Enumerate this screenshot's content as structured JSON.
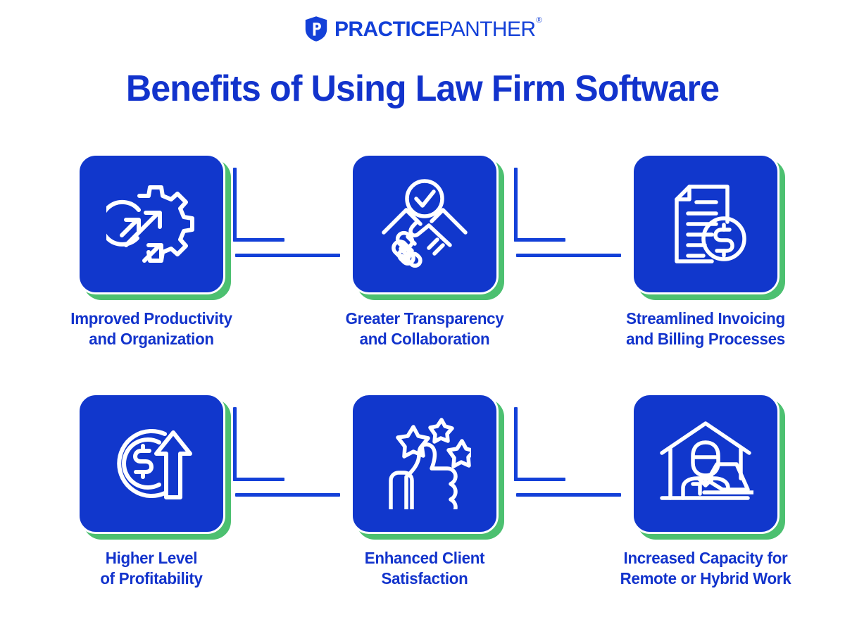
{
  "brand": {
    "logo_icon": "practicepanther-shield-p-icon",
    "name_bold": "PRACTICE",
    "name_light": "PANTHER",
    "registered_mark": "®",
    "color_blue": "#1340d8"
  },
  "header": {
    "title": "Benefits of Using Law Firm Software"
  },
  "theme": {
    "card_blue": "#1137cc",
    "card_shadow_green": "#4cc070",
    "text_blue": "#1233cc",
    "icon_white": "#ffffff",
    "background": "#ffffff"
  },
  "benefits": [
    {
      "icon": "gear-with-growth-arrows-icon",
      "caption_line1": "Improved Productivity",
      "caption_line2": "and Organization"
    },
    {
      "icon": "handshake-with-check-icon",
      "caption_line1": "Greater Transparency",
      "caption_line2": "and Collaboration"
    },
    {
      "icon": "invoice-document-dollar-icon",
      "caption_line1": "Streamlined Invoicing",
      "caption_line2": "and Billing Processes"
    },
    {
      "icon": "dollar-coin-up-arrow-icon",
      "caption_line1": "Higher Level",
      "caption_line2": "of Profitability"
    },
    {
      "icon": "thumbs-up-stars-icon",
      "caption_line1": "Enhanced Client",
      "caption_line2": "Satisfaction"
    },
    {
      "icon": "remote-work-house-laptop-icon",
      "caption_line1": "Increased Capacity for",
      "caption_line2": "Remote or Hybrid Work"
    }
  ],
  "connectors": [
    {
      "name": "connector-1-to-2"
    },
    {
      "name": "connector-2-to-3"
    },
    {
      "name": "connector-4-to-5"
    },
    {
      "name": "connector-5-to-6"
    }
  ]
}
